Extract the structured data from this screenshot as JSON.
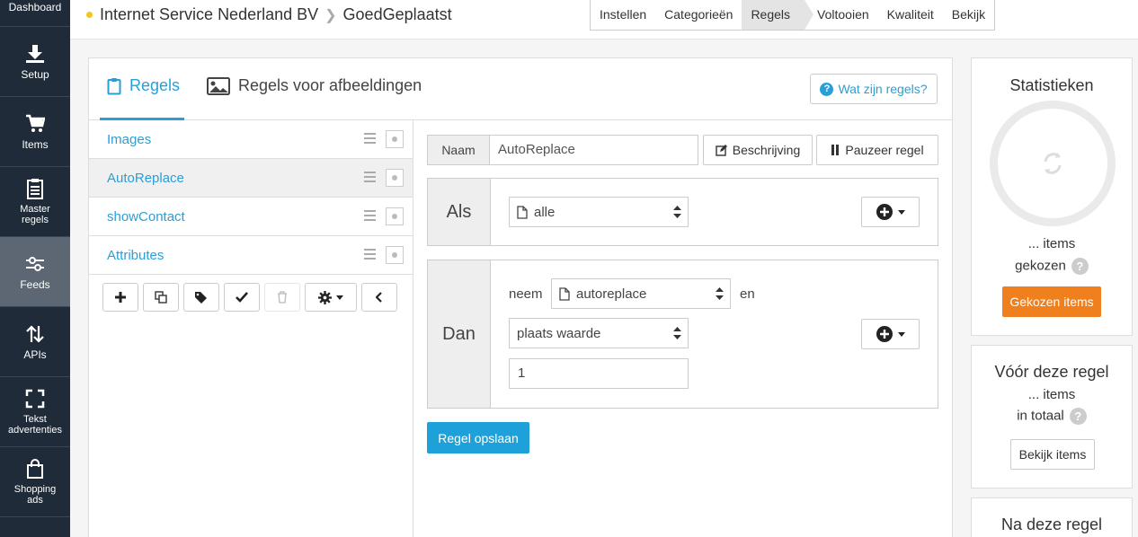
{
  "sidebar": {
    "items": [
      {
        "label": "Dashboard",
        "icon": "dashboard"
      },
      {
        "label": "Setup",
        "icon": "download-icon"
      },
      {
        "label": "Items",
        "icon": "cart-icon"
      },
      {
        "label": "Master regels",
        "icon": "clipboard-icon"
      },
      {
        "label": "Feeds",
        "icon": "sliders-icon",
        "active": true
      },
      {
        "label": "APIs",
        "icon": "arrows-updown-icon"
      },
      {
        "label": "Tekst advertenties",
        "icon": "expand-icon"
      },
      {
        "label": "Shopping ads",
        "icon": "bag-icon"
      }
    ]
  },
  "header": {
    "company": "Internet Service Nederland BV",
    "feed": "GoedGeplaatst",
    "status_color": "#f5c518",
    "steps": [
      "Instellen",
      "Categorieën",
      "Regels",
      "Voltooien",
      "Kwaliteit",
      "Bekijk"
    ],
    "active_step": "Regels"
  },
  "tabs": {
    "rules": "Regels",
    "image_rules": "Regels voor afbeeldingen",
    "help": "Wat zijn regels?"
  },
  "rules": [
    {
      "name": "Images"
    },
    {
      "name": "AutoReplace",
      "selected": true
    },
    {
      "name": "showContact"
    },
    {
      "name": "Attributes"
    }
  ],
  "editor": {
    "naam_label": "Naam",
    "naam_value": "AutoReplace",
    "beschrijving": "Beschrijving",
    "pauzeer": "Pauzeer regel",
    "als_label": "Als",
    "als_select": "alle",
    "dan_label": "Dan",
    "neem": "neem",
    "neem_select": "autoreplace",
    "en": "en",
    "action_select": "plaats waarde",
    "value": "1",
    "save": "Regel opslaan"
  },
  "stats": {
    "title": "Statistieken",
    "items_line": "... items",
    "gekozen": "gekozen",
    "button": "Gekozen items",
    "before_title": "Vóór deze regel",
    "before_items": "... items",
    "before_total": "in totaal",
    "before_button": "Bekijk items",
    "after_title": "Na deze regel"
  },
  "colors": {
    "accent": "#2a9fd6",
    "save": "#1ea1d8",
    "orange": "#f07f1e",
    "sidebar": "#1f2b38"
  }
}
